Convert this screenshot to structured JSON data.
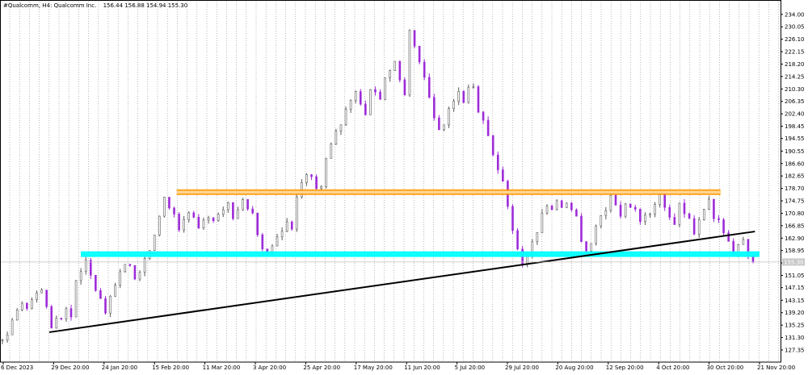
{
  "header": {
    "symbol_line": "#Qualcomm, H4:  Qualcomm Inc.",
    "ohlc": "156.44 156.88 154.94 155.30"
  },
  "current_price_label": "155.30",
  "chart_data": {
    "type": "candlestick",
    "title": "#Qualcomm, H4:  Qualcomm Inc.",
    "timeframe": "H4",
    "ohlc_last": {
      "open": 156.44,
      "high": 156.88,
      "low": 154.94,
      "close": 155.3
    },
    "ylim": [
      123.5,
      236.0
    ],
    "y_ticks": [
      "234.00",
      "230.05",
      "226.10",
      "222.15",
      "218.20",
      "214.25",
      "210.30",
      "206.35",
      "202.40",
      "198.45",
      "194.55",
      "190.55",
      "186.60",
      "182.65",
      "178.70",
      "174.75",
      "170.80",
      "166.85",
      "162.90",
      "158.95",
      "155.00",
      "151.05",
      "147.15",
      "143.15",
      "139.20",
      "135.25",
      "131.30",
      "127.35"
    ],
    "x_ticks": [
      "6 Dec 2023",
      "29 Dec 20:00",
      "24 Jan 20:00",
      "15 Feb 20:00",
      "11 Mar 20:00",
      "3 Apr 20:00",
      "25 Apr 20:00",
      "17 May 20:00",
      "11 Jun 20:00",
      "5 Jul 20:00",
      "29 Jul 20:00",
      "20 Aug 20:00",
      "12 Sep 20:00",
      "4 Oct 20:00",
      "30 Oct 20:00",
      "21 Nov 20:00"
    ],
    "price_path": [
      [
        0,
        130.5
      ],
      [
        2,
        133
      ],
      [
        4,
        137
      ],
      [
        6,
        141
      ],
      [
        8,
        142
      ],
      [
        10,
        141
      ],
      [
        12,
        143
      ],
      [
        14,
        145.5
      ],
      [
        16,
        146
      ],
      [
        18,
        141
      ],
      [
        20,
        135
      ],
      [
        22,
        136.5
      ],
      [
        24,
        138
      ],
      [
        26,
        139.5
      ],
      [
        28,
        138
      ],
      [
        30,
        149
      ],
      [
        32,
        153
      ],
      [
        34,
        156
      ],
      [
        36,
        151
      ],
      [
        38,
        147
      ],
      [
        40,
        144
      ],
      [
        42,
        140
      ],
      [
        44,
        145
      ],
      [
        46,
        148
      ],
      [
        48,
        152
      ],
      [
        50,
        154
      ],
      [
        52,
        155
      ],
      [
        54,
        150
      ],
      [
        56,
        153
      ],
      [
        58,
        156
      ],
      [
        60,
        158
      ],
      [
        62,
        164
      ],
      [
        64,
        170
      ],
      [
        66,
        176
      ],
      [
        68,
        173
      ],
      [
        70,
        170
      ],
      [
        72,
        166
      ],
      [
        74,
        168
      ],
      [
        76,
        170
      ],
      [
        78,
        169
      ],
      [
        80,
        166
      ],
      [
        82,
        169
      ],
      [
        84,
        170
      ],
      [
        86,
        168
      ],
      [
        88,
        171
      ],
      [
        90,
        173
      ],
      [
        92,
        174
      ],
      [
        94,
        170
      ],
      [
        96,
        172
      ],
      [
        98,
        175
      ],
      [
        100,
        173
      ],
      [
        102,
        170
      ],
      [
        104,
        165
      ],
      [
        106,
        159
      ],
      [
        108,
        158
      ],
      [
        110,
        161
      ],
      [
        112,
        164
      ],
      [
        114,
        166
      ],
      [
        116,
        168
      ],
      [
        118,
        165
      ],
      [
        120,
        176
      ],
      [
        122,
        181
      ],
      [
        124,
        184
      ],
      [
        126,
        183
      ],
      [
        128,
        178
      ],
      [
        130,
        180
      ],
      [
        132,
        188
      ],
      [
        134,
        193
      ],
      [
        136,
        197
      ],
      [
        138,
        200
      ],
      [
        140,
        204
      ],
      [
        142,
        207
      ],
      [
        144,
        209
      ],
      [
        146,
        206
      ],
      [
        148,
        203
      ],
      [
        150,
        211
      ],
      [
        152,
        210
      ],
      [
        154,
        208
      ],
      [
        156,
        214
      ],
      [
        158,
        216
      ],
      [
        160,
        219
      ],
      [
        162,
        214
      ],
      [
        164,
        208
      ],
      [
        166,
        228
      ],
      [
        168,
        224
      ],
      [
        170,
        218
      ],
      [
        172,
        214
      ],
      [
        174,
        207
      ],
      [
        176,
        201
      ],
      [
        178,
        197
      ],
      [
        180,
        199
      ],
      [
        182,
        203
      ],
      [
        184,
        206
      ],
      [
        186,
        209
      ],
      [
        188,
        206
      ],
      [
        190,
        210
      ],
      [
        192,
        212
      ],
      [
        194,
        203
      ],
      [
        196,
        200
      ],
      [
        198,
        195
      ],
      [
        200,
        190
      ],
      [
        202,
        185
      ],
      [
        204,
        180
      ],
      [
        206,
        174
      ],
      [
        208,
        166
      ],
      [
        210,
        160
      ],
      [
        212,
        155
      ],
      [
        214,
        157
      ],
      [
        216,
        161
      ],
      [
        218,
        165
      ],
      [
        220,
        170
      ],
      [
        222,
        174
      ],
      [
        224,
        172
      ],
      [
        226,
        175
      ],
      [
        228,
        173
      ],
      [
        230,
        175
      ],
      [
        232,
        172
      ],
      [
        234,
        169
      ],
      [
        236,
        162
      ],
      [
        238,
        159
      ],
      [
        240,
        162
      ],
      [
        242,
        166
      ],
      [
        244,
        170
      ],
      [
        246,
        172
      ],
      [
        248,
        176
      ],
      [
        250,
        174
      ],
      [
        252,
        169
      ],
      [
        254,
        174
      ],
      [
        256,
        172
      ],
      [
        258,
        173
      ],
      [
        260,
        169
      ],
      [
        262,
        170
      ],
      [
        264,
        171
      ],
      [
        266,
        174
      ],
      [
        268,
        176
      ],
      [
        270,
        172
      ],
      [
        272,
        170
      ],
      [
        274,
        168
      ],
      [
        276,
        173
      ],
      [
        278,
        171
      ],
      [
        280,
        169
      ],
      [
        282,
        165
      ],
      [
        284,
        168
      ],
      [
        286,
        172
      ],
      [
        288,
        175
      ],
      [
        290,
        170
      ],
      [
        292,
        169
      ],
      [
        294,
        164
      ],
      [
        296,
        162
      ],
      [
        298,
        158
      ],
      [
        300,
        160
      ],
      [
        302,
        163
      ],
      [
        304,
        158
      ],
      [
        306,
        155.3
      ]
    ],
    "annotations": [
      {
        "type": "horizontal_zone",
        "color": "#ff9900",
        "level": 177.5,
        "from_date": "26 Feb",
        "to_date": "4 Nov"
      },
      {
        "type": "horizontal_zone",
        "color": "#00ffff",
        "level": 157.8,
        "from_date": "12 Jan",
        "to_date": "21 Nov"
      },
      {
        "type": "trendline",
        "color": "#000000",
        "from": {
          "date": "27 Dec",
          "price": 133.0
        },
        "to": {
          "date": "19 Nov",
          "price": 165.0
        }
      }
    ],
    "candle_colors": {
      "up": "#5a5a5a",
      "down": "#9d2bd8"
    },
    "grid": "vertical dotted",
    "current_price_line_color": "#c0c0c0"
  }
}
